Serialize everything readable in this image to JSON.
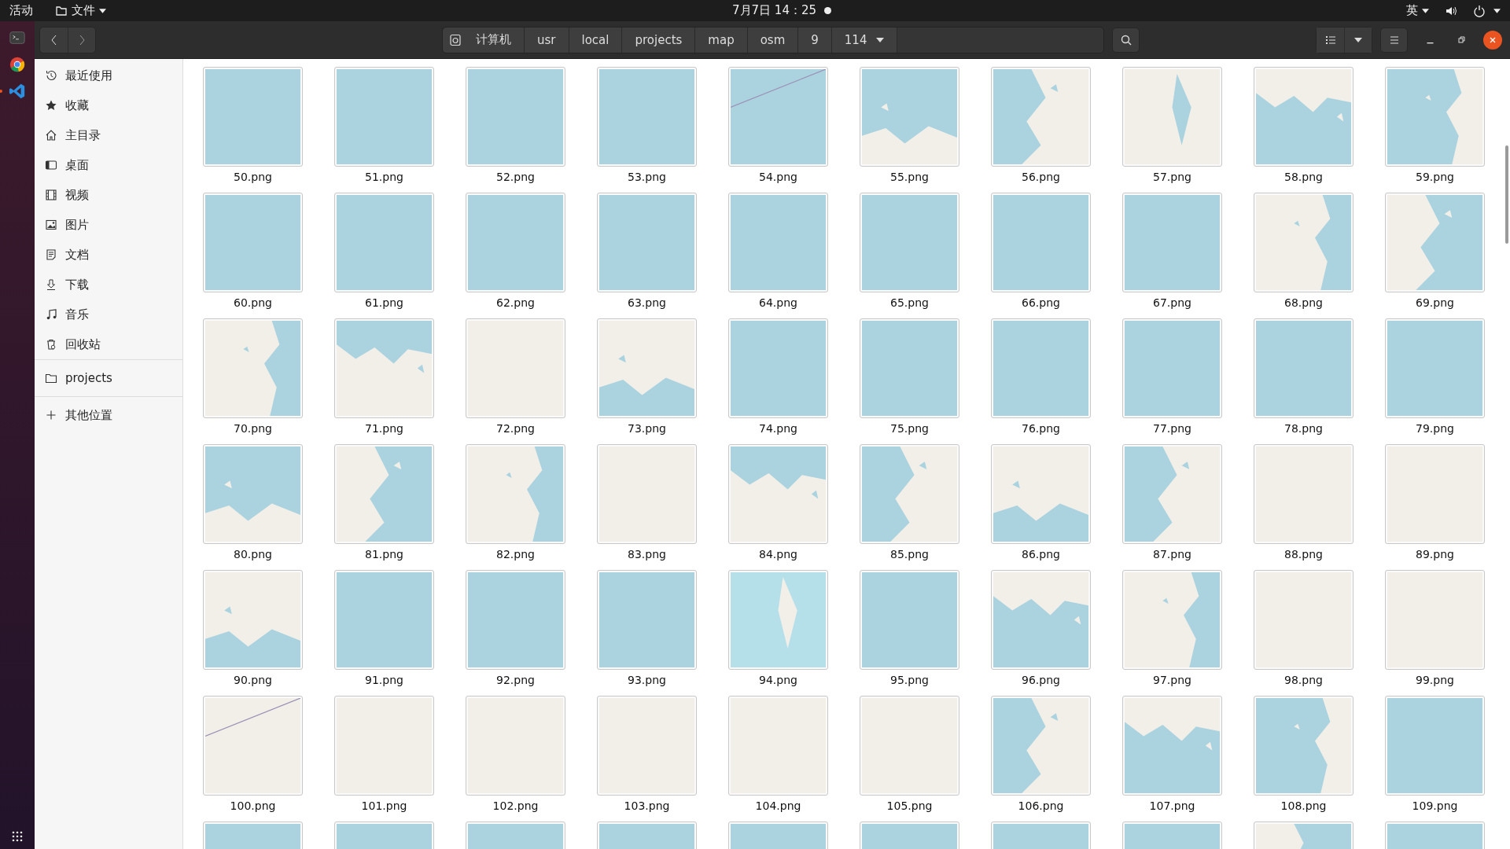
{
  "top_bar": {
    "activities": "活动",
    "app_menu": "文件",
    "clock": "7月7日 14：25",
    "input_method": "英"
  },
  "header": {
    "path": [
      {
        "label": "计算机",
        "kind": "computer"
      },
      {
        "label": "usr",
        "kind": "folder"
      },
      {
        "label": "local",
        "kind": "folder"
      },
      {
        "label": "projects",
        "kind": "folder"
      },
      {
        "label": "map",
        "kind": "folder"
      },
      {
        "label": "osm",
        "kind": "folder"
      },
      {
        "label": "9",
        "kind": "folder"
      },
      {
        "label": "114",
        "kind": "current"
      }
    ]
  },
  "sidebar": {
    "places": [
      {
        "label": "最近使用",
        "selected": false
      },
      {
        "label": "收藏",
        "selected": false
      },
      {
        "label": "主目录",
        "selected": false
      },
      {
        "label": "桌面",
        "selected": false
      },
      {
        "label": "视频",
        "selected": false
      },
      {
        "label": "图片",
        "selected": false
      },
      {
        "label": "文档",
        "selected": false
      },
      {
        "label": "下载",
        "selected": false
      },
      {
        "label": "音乐",
        "selected": false
      },
      {
        "label": "回收站",
        "selected": false
      }
    ],
    "bookmarks": [
      {
        "label": "projects",
        "selected": false
      }
    ],
    "other": [
      {
        "label": "其他位置",
        "selected": false
      }
    ]
  },
  "files": [
    {
      "name": "50.png"
    },
    {
      "name": "51.png"
    },
    {
      "name": "52.png"
    },
    {
      "name": "53.png"
    },
    {
      "name": "54.png"
    },
    {
      "name": "55.png"
    },
    {
      "name": "56.png"
    },
    {
      "name": "57.png"
    },
    {
      "name": "58.png"
    },
    {
      "name": "59.png"
    },
    {
      "name": "60.png"
    },
    {
      "name": "61.png"
    },
    {
      "name": "62.png"
    },
    {
      "name": "63.png"
    },
    {
      "name": "64.png"
    },
    {
      "name": "65.png"
    },
    {
      "name": "66.png"
    },
    {
      "name": "67.png"
    },
    {
      "name": "68.png"
    },
    {
      "name": "69.png"
    },
    {
      "name": "70.png"
    },
    {
      "name": "71.png"
    },
    {
      "name": "72.png"
    },
    {
      "name": "73.png"
    },
    {
      "name": "74.png"
    },
    {
      "name": "75.png"
    },
    {
      "name": "76.png"
    },
    {
      "name": "77.png"
    },
    {
      "name": "78.png"
    },
    {
      "name": "79.png"
    },
    {
      "name": "80.png"
    },
    {
      "name": "81.png"
    },
    {
      "name": "82.png"
    },
    {
      "name": "83.png"
    },
    {
      "name": "84.png"
    },
    {
      "name": "85.png"
    },
    {
      "name": "86.png"
    },
    {
      "name": "87.png"
    },
    {
      "name": "88.png"
    },
    {
      "name": "89.png"
    },
    {
      "name": "90.png"
    },
    {
      "name": "91.png"
    },
    {
      "name": "92.png"
    },
    {
      "name": "93.png"
    },
    {
      "name": "94.png"
    },
    {
      "name": "95.png"
    },
    {
      "name": "96.png"
    },
    {
      "name": "97.png"
    },
    {
      "name": "98.png"
    },
    {
      "name": "99.png"
    },
    {
      "name": "100.png"
    },
    {
      "name": "101.png"
    },
    {
      "name": "102.png"
    },
    {
      "name": "103.png"
    },
    {
      "name": "104.png"
    },
    {
      "name": "105.png"
    },
    {
      "name": "106.png"
    },
    {
      "name": "107.png"
    },
    {
      "name": "108.png"
    },
    {
      "name": "109.png"
    },
    {
      "kind": "picture"
    },
    {
      "kind": "picture"
    },
    {
      "kind": "picture"
    },
    {
      "kind": "picture"
    },
    {
      "kind": "picture"
    },
    {
      "kind": "picture"
    },
    {
      "kind": "picture"
    },
    {
      "kind": "picture"
    },
    {
      "kind": "picture"
    },
    {
      "kind": "picture"
    }
  ]
}
